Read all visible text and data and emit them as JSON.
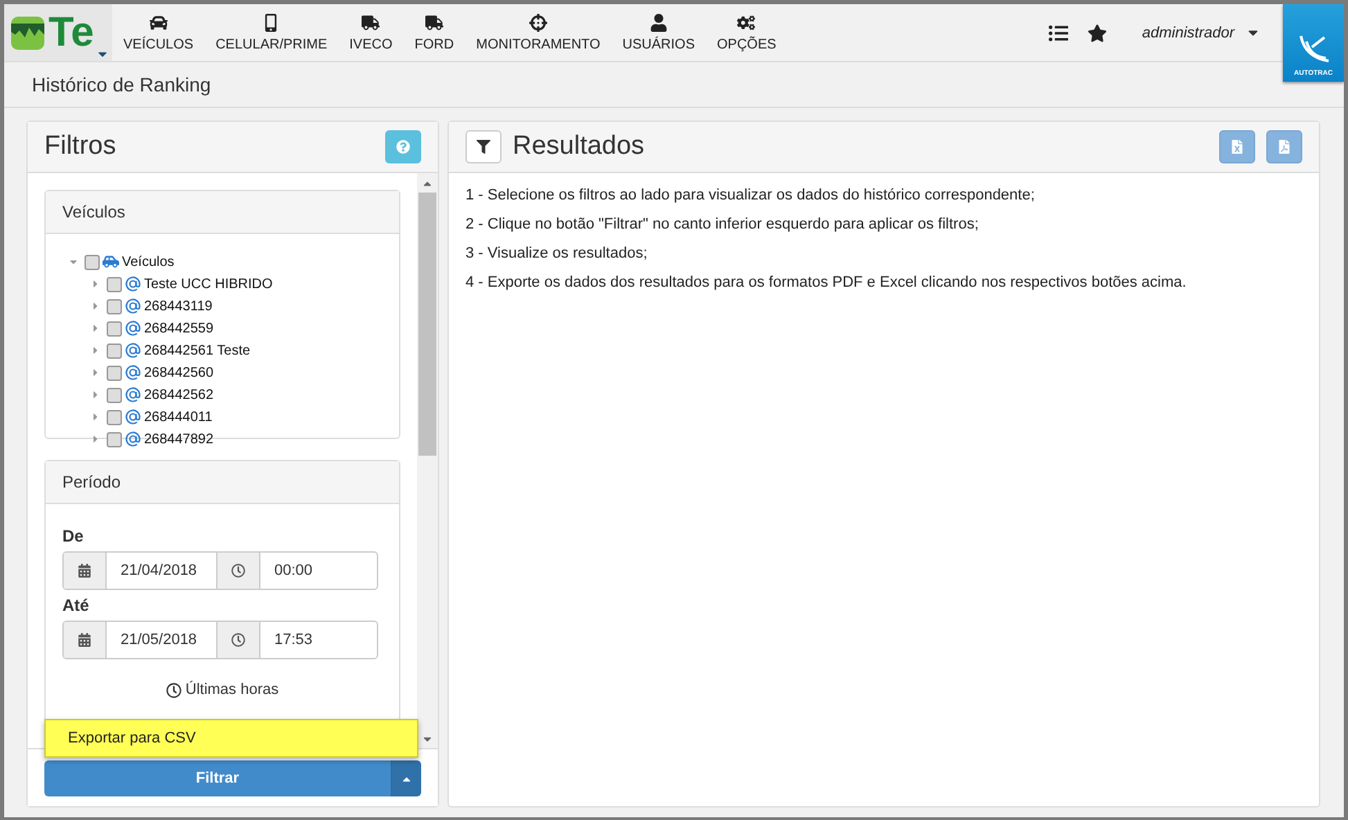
{
  "app_logo": {
    "text": "Te"
  },
  "nav": [
    {
      "label": "VEÍCULOS"
    },
    {
      "label": "CELULAR/PRIME"
    },
    {
      "label": "IVECO"
    },
    {
      "label": "FORD"
    },
    {
      "label": "MONITORAMENTO"
    },
    {
      "label": "USUÁRIOS"
    },
    {
      "label": "OPÇÕES"
    }
  ],
  "user": {
    "name": "administrador"
  },
  "brand_logo": {
    "text": "AUTOTRAC"
  },
  "page_title": "Histórico de Ranking",
  "filters": {
    "title": "Filtros",
    "vehicles": {
      "title": "Veículos",
      "tree": {
        "label": "Veículos",
        "expanded": true,
        "checked": false,
        "children": [
          {
            "label": "Teste UCC HIBRIDO",
            "expanded": false,
            "checked": false
          },
          {
            "label": "268443119",
            "expanded": false,
            "checked": false
          },
          {
            "label": "268442559",
            "expanded": false,
            "checked": false
          },
          {
            "label": "268442561 Teste",
            "expanded": false,
            "checked": false
          },
          {
            "label": "268442560",
            "expanded": false,
            "checked": false
          },
          {
            "label": "268442562",
            "expanded": false,
            "checked": false
          },
          {
            "label": "268444011",
            "expanded": false,
            "checked": false
          },
          {
            "label": "268447892",
            "expanded": false,
            "checked": false
          }
        ]
      }
    },
    "period": {
      "title": "Período",
      "ranges": [
        {
          "label": "De",
          "date": "21/04/2018",
          "time": "00:00"
        },
        {
          "label": "Até",
          "date": "21/05/2018",
          "time": "17:53"
        }
      ],
      "last_hours": "Últimas horas"
    },
    "dropdown": {
      "items": [
        "Exportar para CSV"
      ]
    },
    "filter_button": "Filtrar"
  },
  "results": {
    "title": "Resultados",
    "instructions": [
      "1 - Selecione os filtros ao lado para visualizar os dados do histórico correspondente;",
      "2 - Clique no botão \"Filtrar\" no canto inferior esquerdo para aplicar os filtros;",
      "3 - Visualize os resultados;",
      "4 - Exporte os dados dos resultados para os formatos PDF e Excel clicando nos respectivos botões acima."
    ]
  }
}
